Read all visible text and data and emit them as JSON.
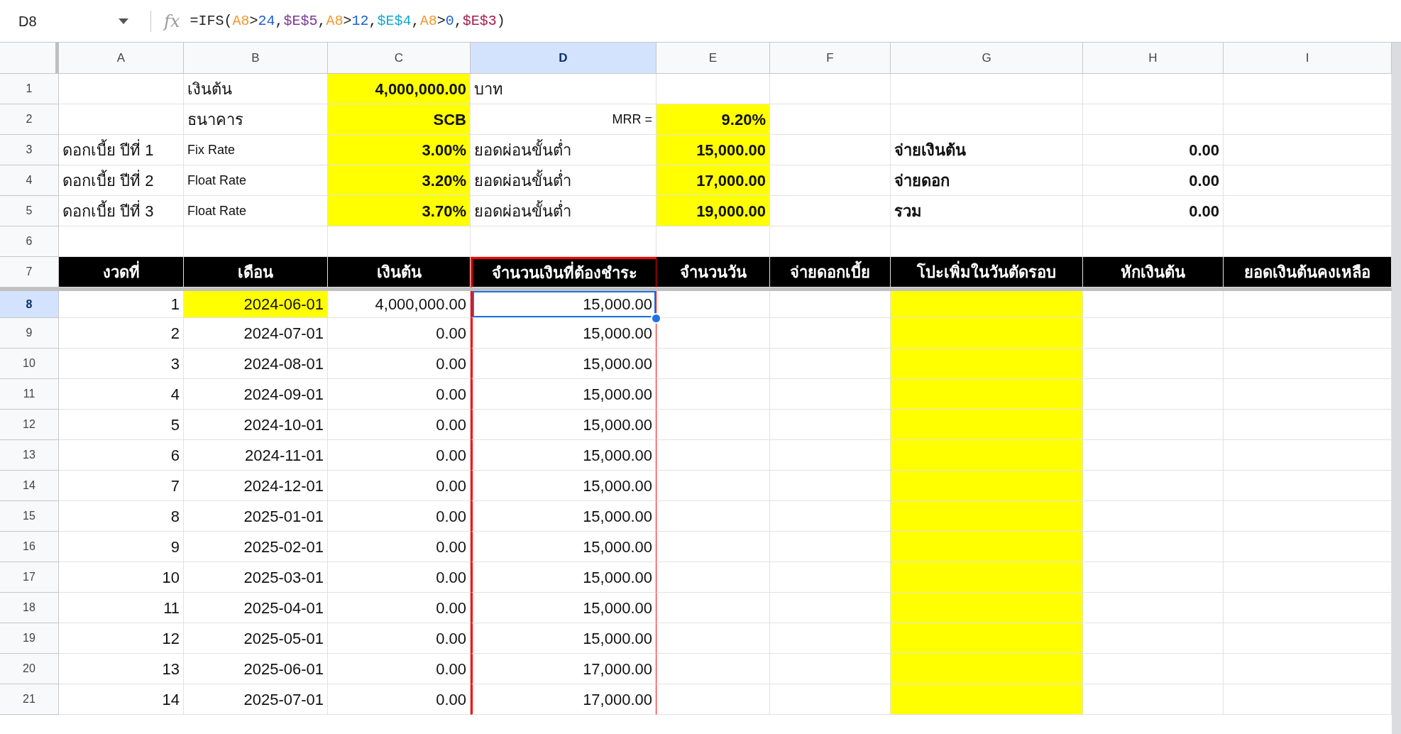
{
  "formula_bar": {
    "name_box": "D8",
    "fx_label": "fx",
    "formula": [
      {
        "text": "=IFS(",
        "color": "#1f1f1f"
      },
      {
        "text": "A8",
        "color": "#f09a2c"
      },
      {
        "text": ">",
        "color": "#1f1f1f"
      },
      {
        "text": "24",
        "color": "#1a5fd8"
      },
      {
        "text": ",",
        "color": "#1f1f1f"
      },
      {
        "text": "$E$5",
        "color": "#7e3794"
      },
      {
        "text": ",",
        "color": "#1f1f1f"
      },
      {
        "text": "A8",
        "color": "#f09a2c"
      },
      {
        "text": ">",
        "color": "#1f1f1f"
      },
      {
        "text": "12",
        "color": "#1a5fd8"
      },
      {
        "text": ",",
        "color": "#1f1f1f"
      },
      {
        "text": "$E$4",
        "color": "#11a9cc"
      },
      {
        "text": ",",
        "color": "#1f1f1f"
      },
      {
        "text": "A8",
        "color": "#f09a2c"
      },
      {
        "text": ">",
        "color": "#1f1f1f"
      },
      {
        "text": "0",
        "color": "#1a5fd8"
      },
      {
        "text": ",",
        "color": "#1f1f1f"
      },
      {
        "text": "$E$3",
        "color": "#a61d4c"
      },
      {
        "text": ")",
        "color": "#1f1f1f"
      }
    ]
  },
  "columns": [
    {
      "letter": "A",
      "selected": false,
      "outlined": false
    },
    {
      "letter": "B",
      "selected": false,
      "outlined": false
    },
    {
      "letter": "C",
      "selected": false,
      "outlined": false
    },
    {
      "letter": "D",
      "selected": true,
      "outlined": true
    },
    {
      "letter": "E",
      "selected": false,
      "outlined": false
    },
    {
      "letter": "F",
      "selected": false,
      "outlined": false
    },
    {
      "letter": "G",
      "selected": false,
      "outlined": false
    },
    {
      "letter": "H",
      "selected": false,
      "outlined": false
    },
    {
      "letter": "I",
      "selected": false,
      "outlined": false
    }
  ],
  "rows": [
    {
      "number": "1",
      "selected": false,
      "kind": "plain",
      "cells": [
        {
          "highlighted": false
        },
        {
          "text": "เงินต้น",
          "kind": "text",
          "bold": false,
          "highlighted": false
        },
        {
          "text": "4,000,000.00",
          "kind": "value",
          "bold": true,
          "highlighted": true
        },
        {
          "text": "บาท",
          "kind": "text",
          "bold": false,
          "highlighted": false
        },
        {
          "highlighted": false
        },
        {
          "highlighted": false
        },
        {
          "highlighted": false
        },
        {
          "highlighted": false
        },
        {
          "highlighted": false
        }
      ]
    },
    {
      "number": "2",
      "selected": false,
      "kind": "plain",
      "cells": [
        {
          "highlighted": false
        },
        {
          "text": "ธนาคาร",
          "kind": "text",
          "bold": false,
          "highlighted": false
        },
        {
          "text": "SCB",
          "kind": "value",
          "bold": true,
          "highlighted": true
        },
        {
          "text": "MRR =",
          "kind": "smallvalue",
          "bold": false,
          "highlighted": false
        },
        {
          "text": "9.20%",
          "kind": "value",
          "bold": true,
          "highlighted": true
        },
        {
          "highlighted": false
        },
        {
          "highlighted": false
        },
        {
          "highlighted": false
        },
        {
          "highlighted": false
        }
      ]
    },
    {
      "number": "3",
      "selected": false,
      "kind": "plain",
      "cells": [
        {
          "text": "ดอกเบี้ย ปีที่ 1",
          "kind": "text",
          "bold": false,
          "highlighted": false
        },
        {
          "text": "Fix Rate",
          "kind": "smalltext",
          "bold": false,
          "highlighted": false
        },
        {
          "text": "3.00%",
          "kind": "value",
          "bold": true,
          "highlighted": true
        },
        {
          "text": "ยอดผ่อนขั้นต่ำ",
          "kind": "text",
          "bold": false,
          "highlighted": false
        },
        {
          "text": "15,000.00",
          "kind": "value",
          "bold": true,
          "highlighted": true
        },
        {
          "highlighted": false
        },
        {
          "text": "จ่ายเงินต้น",
          "kind": "text",
          "bold": true,
          "highlighted": false
        },
        {
          "text": "0.00",
          "kind": "value",
          "bold": true,
          "highlighted": false
        },
        {
          "highlighted": false
        }
      ]
    },
    {
      "number": "4",
      "selected": false,
      "kind": "plain",
      "cells": [
        {
          "text": "ดอกเบี้ย ปีที่ 2",
          "kind": "text",
          "bold": false,
          "highlighted": false
        },
        {
          "text": "Float Rate",
          "kind": "smalltext",
          "bold": false,
          "highlighted": false
        },
        {
          "text": "3.20%",
          "kind": "value",
          "bold": true,
          "highlighted": true
        },
        {
          "text": "ยอดผ่อนขั้นต่ำ",
          "kind": "text",
          "bold": false,
          "highlighted": false
        },
        {
          "text": "17,000.00",
          "kind": "value",
          "bold": true,
          "highlighted": true
        },
        {
          "highlighted": false
        },
        {
          "text": "จ่ายดอก",
          "kind": "text",
          "bold": true,
          "highlighted": false
        },
        {
          "text": "0.00",
          "kind": "value",
          "bold": true,
          "highlighted": false
        },
        {
          "highlighted": false
        }
      ]
    },
    {
      "number": "5",
      "selected": false,
      "kind": "plain",
      "cells": [
        {
          "text": "ดอกเบี้ย ปีที่ 3",
          "kind": "text",
          "bold": false,
          "highlighted": false
        },
        {
          "text": "Float Rate",
          "kind": "smalltext",
          "bold": false,
          "highlighted": false
        },
        {
          "text": "3.70%",
          "kind": "value",
          "bold": true,
          "highlighted": true
        },
        {
          "text": "ยอดผ่อนขั้นต่ำ",
          "kind": "text",
          "bold": false,
          "highlighted": false
        },
        {
          "text": "19,000.00",
          "kind": "value",
          "bold": true,
          "highlighted": true
        },
        {
          "highlighted": false
        },
        {
          "text": "รวม",
          "kind": "text",
          "bold": true,
          "highlighted": false
        },
        {
          "text": "0.00",
          "kind": "value",
          "bold": true,
          "highlighted": false
        },
        {
          "highlighted": false
        }
      ]
    },
    {
      "number": "6",
      "selected": false,
      "kind": "plain",
      "cells": [
        {
          "highlighted": false
        },
        {
          "highlighted": false
        },
        {
          "highlighted": false
        },
        {
          "highlighted": false
        },
        {
          "highlighted": false
        },
        {
          "highlighted": false
        },
        {
          "highlighted": false
        },
        {
          "highlighted": false
        },
        {
          "highlighted": false
        }
      ]
    },
    {
      "number": "7",
      "selected": false,
      "kind": "header",
      "cells": [
        {
          "text": "งวดที่",
          "kind": "heading",
          "bold": true,
          "highlighted": false
        },
        {
          "text": "เดือน",
          "kind": "heading",
          "bold": true,
          "highlighted": false
        },
        {
          "text": "เงินต้น",
          "kind": "heading",
          "bold": true,
          "highlighted": false
        },
        {
          "text": "จำนวนเงินที่ต้องชำระ",
          "kind": "heading",
          "bold": true,
          "highlighted": false
        },
        {
          "text": "จำนวนวัน",
          "kind": "heading",
          "bold": true,
          "highlighted": false
        },
        {
          "text": "จ่ายดอกเบี้ย",
          "kind": "heading",
          "bold": true,
          "highlighted": false
        },
        {
          "text": "โปะเพิ่มในวันตัดรอบ",
          "kind": "heading",
          "bold": true,
          "highlighted": false
        },
        {
          "text": "หักเงินต้น",
          "kind": "heading",
          "bold": true,
          "highlighted": false
        },
        {
          "text": "ยอดเงินต้นคงเหลือ",
          "kind": "heading",
          "bold": true,
          "highlighted": false
        }
      ]
    },
    {
      "number": "8",
      "selected": true,
      "kind": "plain",
      "cells": [
        {
          "text": "1",
          "kind": "value",
          "bold": false,
          "highlighted": false
        },
        {
          "text": "2024-06-01",
          "kind": "value",
          "bold": false,
          "highlighted": true
        },
        {
          "text": "4,000,000.00",
          "kind": "value",
          "bold": false,
          "highlighted": false
        },
        {
          "text": "15,000.00",
          "kind": "value",
          "bold": false,
          "highlighted": false
        },
        {
          "highlighted": false
        },
        {
          "highlighted": false
        },
        {
          "highlighted": true
        },
        {
          "highlighted": false
        },
        {
          "highlighted": false
        }
      ]
    },
    {
      "number": "9",
      "selected": false,
      "kind": "plain",
      "cells": [
        {
          "text": "2",
          "kind": "value",
          "bold": false,
          "highlighted": false
        },
        {
          "text": "2024-07-01",
          "kind": "value",
          "bold": false,
          "highlighted": false
        },
        {
          "text": "0.00",
          "kind": "value",
          "bold": false,
          "highlighted": false
        },
        {
          "text": "15,000.00",
          "kind": "value",
          "bold": false,
          "highlighted": false
        },
        {
          "highlighted": false
        },
        {
          "highlighted": false
        },
        {
          "highlighted": true
        },
        {
          "highlighted": false
        },
        {
          "highlighted": false
        }
      ]
    },
    {
      "number": "10",
      "selected": false,
      "kind": "plain",
      "cells": [
        {
          "text": "3",
          "kind": "value",
          "bold": false,
          "highlighted": false
        },
        {
          "text": "2024-08-01",
          "kind": "value",
          "bold": false,
          "highlighted": false
        },
        {
          "text": "0.00",
          "kind": "value",
          "bold": false,
          "highlighted": false
        },
        {
          "text": "15,000.00",
          "kind": "value",
          "bold": false,
          "highlighted": false
        },
        {
          "highlighted": false
        },
        {
          "highlighted": false
        },
        {
          "highlighted": true
        },
        {
          "highlighted": false
        },
        {
          "highlighted": false
        }
      ]
    },
    {
      "number": "11",
      "selected": false,
      "kind": "plain",
      "cells": [
        {
          "text": "4",
          "kind": "value",
          "bold": false,
          "highlighted": false
        },
        {
          "text": "2024-09-01",
          "kind": "value",
          "bold": false,
          "highlighted": false
        },
        {
          "text": "0.00",
          "kind": "value",
          "bold": false,
          "highlighted": false
        },
        {
          "text": "15,000.00",
          "kind": "value",
          "bold": false,
          "highlighted": false
        },
        {
          "highlighted": false
        },
        {
          "highlighted": false
        },
        {
          "highlighted": true
        },
        {
          "highlighted": false
        },
        {
          "highlighted": false
        }
      ]
    },
    {
      "number": "12",
      "selected": false,
      "kind": "plain",
      "cells": [
        {
          "text": "5",
          "kind": "value",
          "bold": false,
          "highlighted": false
        },
        {
          "text": "2024-10-01",
          "kind": "value",
          "bold": false,
          "highlighted": false
        },
        {
          "text": "0.00",
          "kind": "value",
          "bold": false,
          "highlighted": false
        },
        {
          "text": "15,000.00",
          "kind": "value",
          "bold": false,
          "highlighted": false
        },
        {
          "highlighted": false
        },
        {
          "highlighted": false
        },
        {
          "highlighted": true
        },
        {
          "highlighted": false
        },
        {
          "highlighted": false
        }
      ]
    },
    {
      "number": "13",
      "selected": false,
      "kind": "plain",
      "cells": [
        {
          "text": "6",
          "kind": "value",
          "bold": false,
          "highlighted": false
        },
        {
          "text": "2024-11-01",
          "kind": "value",
          "bold": false,
          "highlighted": false
        },
        {
          "text": "0.00",
          "kind": "value",
          "bold": false,
          "highlighted": false
        },
        {
          "text": "15,000.00",
          "kind": "value",
          "bold": false,
          "highlighted": false
        },
        {
          "highlighted": false
        },
        {
          "highlighted": false
        },
        {
          "highlighted": true
        },
        {
          "highlighted": false
        },
        {
          "highlighted": false
        }
      ]
    },
    {
      "number": "14",
      "selected": false,
      "kind": "plain",
      "cells": [
        {
          "text": "7",
          "kind": "value",
          "bold": false,
          "highlighted": false
        },
        {
          "text": "2024-12-01",
          "kind": "value",
          "bold": false,
          "highlighted": false
        },
        {
          "text": "0.00",
          "kind": "value",
          "bold": false,
          "highlighted": false
        },
        {
          "text": "15,000.00",
          "kind": "value",
          "bold": false,
          "highlighted": false
        },
        {
          "highlighted": false
        },
        {
          "highlighted": false
        },
        {
          "highlighted": true
        },
        {
          "highlighted": false
        },
        {
          "highlighted": false
        }
      ]
    },
    {
      "number": "15",
      "selected": false,
      "kind": "plain",
      "cells": [
        {
          "text": "8",
          "kind": "value",
          "bold": false,
          "highlighted": false
        },
        {
          "text": "2025-01-01",
          "kind": "value",
          "bold": false,
          "highlighted": false
        },
        {
          "text": "0.00",
          "kind": "value",
          "bold": false,
          "highlighted": false
        },
        {
          "text": "15,000.00",
          "kind": "value",
          "bold": false,
          "highlighted": false
        },
        {
          "highlighted": false
        },
        {
          "highlighted": false
        },
        {
          "highlighted": true
        },
        {
          "highlighted": false
        },
        {
          "highlighted": false
        }
      ]
    },
    {
      "number": "16",
      "selected": false,
      "kind": "plain",
      "cells": [
        {
          "text": "9",
          "kind": "value",
          "bold": false,
          "highlighted": false
        },
        {
          "text": "2025-02-01",
          "kind": "value",
          "bold": false,
          "highlighted": false
        },
        {
          "text": "0.00",
          "kind": "value",
          "bold": false,
          "highlighted": false
        },
        {
          "text": "15,000.00",
          "kind": "value",
          "bold": false,
          "highlighted": false
        },
        {
          "highlighted": false
        },
        {
          "highlighted": false
        },
        {
          "highlighted": true
        },
        {
          "highlighted": false
        },
        {
          "highlighted": false
        }
      ]
    },
    {
      "number": "17",
      "selected": false,
      "kind": "plain",
      "cells": [
        {
          "text": "10",
          "kind": "value",
          "bold": false,
          "highlighted": false
        },
        {
          "text": "2025-03-01",
          "kind": "value",
          "bold": false,
          "highlighted": false
        },
        {
          "text": "0.00",
          "kind": "value",
          "bold": false,
          "highlighted": false
        },
        {
          "text": "15,000.00",
          "kind": "value",
          "bold": false,
          "highlighted": false
        },
        {
          "highlighted": false
        },
        {
          "highlighted": false
        },
        {
          "highlighted": true
        },
        {
          "highlighted": false
        },
        {
          "highlighted": false
        }
      ]
    },
    {
      "number": "18",
      "selected": false,
      "kind": "plain",
      "cells": [
        {
          "text": "11",
          "kind": "value",
          "bold": false,
          "highlighted": false
        },
        {
          "text": "2025-04-01",
          "kind": "value",
          "bold": false,
          "highlighted": false
        },
        {
          "text": "0.00",
          "kind": "value",
          "bold": false,
          "highlighted": false
        },
        {
          "text": "15,000.00",
          "kind": "value",
          "bold": false,
          "highlighted": false
        },
        {
          "highlighted": false
        },
        {
          "highlighted": false
        },
        {
          "highlighted": true
        },
        {
          "highlighted": false
        },
        {
          "highlighted": false
        }
      ]
    },
    {
      "number": "19",
      "selected": false,
      "kind": "plain",
      "cells": [
        {
          "text": "12",
          "kind": "value",
          "bold": false,
          "highlighted": false
        },
        {
          "text": "2025-05-01",
          "kind": "value",
          "bold": false,
          "highlighted": false
        },
        {
          "text": "0.00",
          "kind": "value",
          "bold": false,
          "highlighted": false
        },
        {
          "text": "15,000.00",
          "kind": "value",
          "bold": false,
          "highlighted": false
        },
        {
          "highlighted": false
        },
        {
          "highlighted": false
        },
        {
          "highlighted": true
        },
        {
          "highlighted": false
        },
        {
          "highlighted": false
        }
      ]
    },
    {
      "number": "20",
      "selected": false,
      "kind": "plain",
      "cells": [
        {
          "text": "13",
          "kind": "value",
          "bold": false,
          "highlighted": false
        },
        {
          "text": "2025-06-01",
          "kind": "value",
          "bold": false,
          "highlighted": false
        },
        {
          "text": "0.00",
          "kind": "value",
          "bold": false,
          "highlighted": false
        },
        {
          "text": "17,000.00",
          "kind": "value",
          "bold": false,
          "highlighted": false
        },
        {
          "highlighted": false
        },
        {
          "highlighted": false
        },
        {
          "highlighted": true
        },
        {
          "highlighted": false
        },
        {
          "highlighted": false
        }
      ]
    },
    {
      "number": "21",
      "selected": false,
      "kind": "plain",
      "cells": [
        {
          "text": "14",
          "kind": "value",
          "bold": false,
          "highlighted": false
        },
        {
          "text": "2025-07-01",
          "kind": "value",
          "bold": false,
          "highlighted": false
        },
        {
          "text": "0.00",
          "kind": "value",
          "bold": false,
          "highlighted": false
        },
        {
          "text": "17,000.00",
          "kind": "value",
          "bold": false,
          "highlighted": false
        },
        {
          "highlighted": false
        },
        {
          "highlighted": false
        },
        {
          "highlighted": true
        },
        {
          "highlighted": false
        },
        {
          "highlighted": false
        }
      ]
    }
  ]
}
